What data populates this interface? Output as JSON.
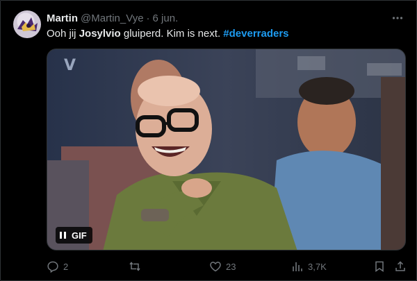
{
  "tweet": {
    "author_name": "Martin",
    "author_handle": "@Martin_Vye",
    "separator": "·",
    "date": "6 jun.",
    "text_before": "Ooh jij ",
    "text_mention": "Josylvio",
    "text_after": " gluiperd. Kim is next. ",
    "hashtag": "#deverraders"
  },
  "media": {
    "badge_label": "GIF",
    "pause_icon": "pause-icon",
    "channel_logo": "V"
  },
  "actions": {
    "reply_count": "2",
    "retweet_count": "",
    "like_count": "23",
    "views_count": "3,7K"
  },
  "icons": {
    "more": "more-icon",
    "reply": "reply-icon",
    "retweet": "retweet-icon",
    "like": "heart-icon",
    "views": "views-icon",
    "bookmark": "bookmark-icon",
    "share": "share-icon"
  },
  "colors": {
    "background": "#000000",
    "text": "#e7e9ea",
    "muted": "#71767b",
    "link": "#1d9bf0",
    "border": "#2f3336"
  }
}
